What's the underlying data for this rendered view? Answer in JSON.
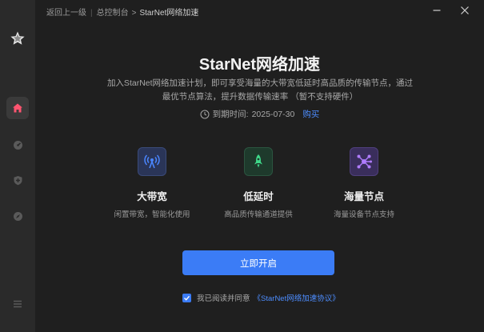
{
  "sidebar": {
    "logo_icon": "star-icon",
    "items": [
      {
        "icon": "home-icon",
        "active": true
      },
      {
        "icon": "speedometer-icon",
        "active": false
      },
      {
        "icon": "shield-icon",
        "active": false
      },
      {
        "icon": "compass-icon",
        "active": false
      }
    ],
    "menu_icon": "menu-icon"
  },
  "topbar": {
    "back_label": "返回上一级",
    "separator": "|",
    "crumb_console": "总控制台",
    "crumb_arrow": ">",
    "crumb_current": "StarNet网络加速"
  },
  "main": {
    "title": "StarNet网络加速",
    "description": "加入StarNet网络加速计划，即可享受海量的大带宽低延时高品质的传输节点，通过最优节点算法，提升数据传输速率 （暂不支持硬件）",
    "expire_label": "到期时间:",
    "expire_date": "2025-07-30",
    "buy_label": "购买"
  },
  "features": [
    {
      "name": "大带宽",
      "desc": "闲置带宽，智能化使用",
      "icon": "antenna-icon",
      "color": "#4a86ff"
    },
    {
      "name": "低延时",
      "desc": "高品质传输通道提供",
      "icon": "rocket-icon",
      "color": "#3fd98a"
    },
    {
      "name": "海量节点",
      "desc": "海量设备节点支持",
      "icon": "nodes-icon",
      "color": "#b07cff"
    }
  ],
  "start_button": "立即开启",
  "agreement": {
    "checked": true,
    "text": "我已阅读并同意",
    "link": "《StarNet网络加速协议》"
  },
  "colors": {
    "accent": "#3b7cf6",
    "link": "#4d8dff",
    "background": "#1f1f1f",
    "sidebar": "#2a2a2a"
  }
}
